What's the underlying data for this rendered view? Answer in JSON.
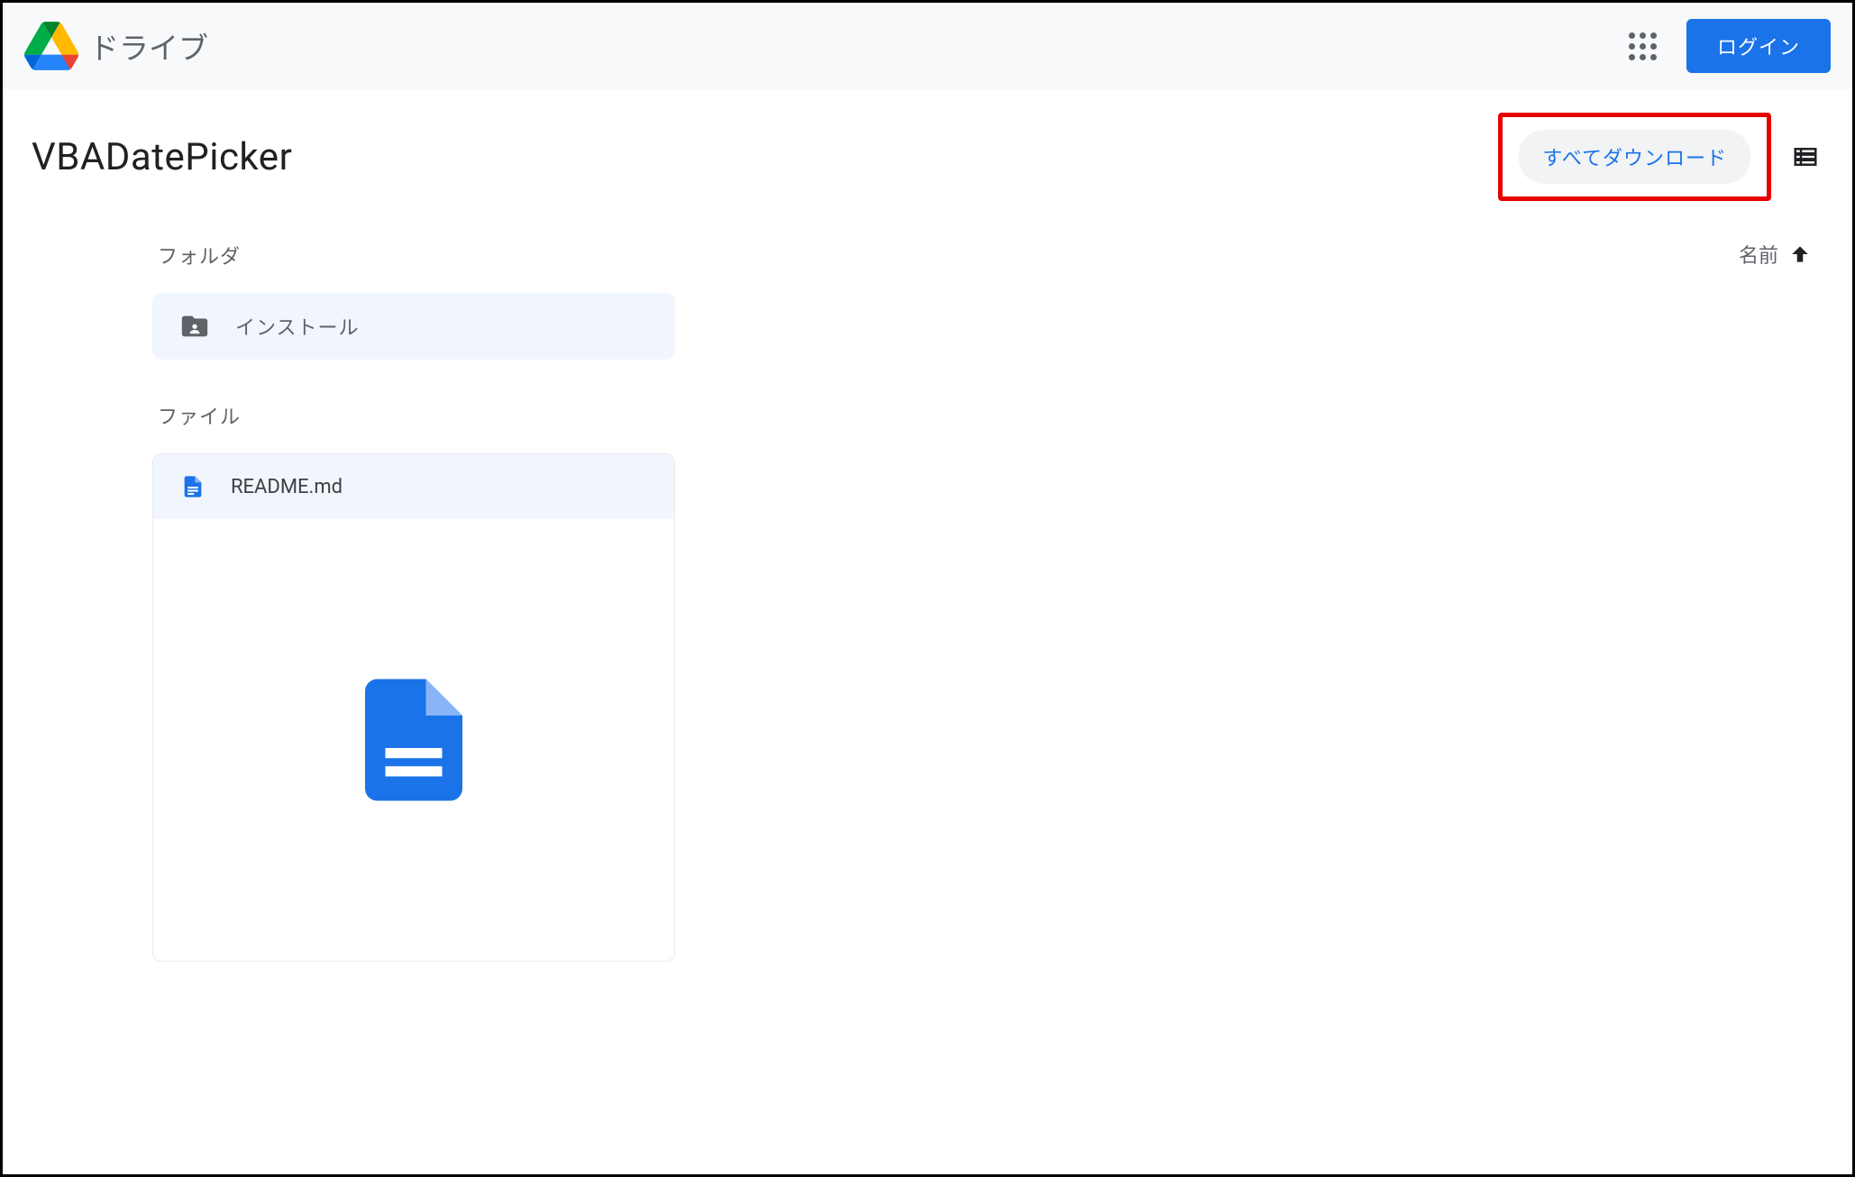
{
  "header": {
    "product_name": "ドライブ",
    "login_label": "ログイン"
  },
  "toolbar": {
    "title": "VBADatePicker",
    "download_all_label": "すべてダウンロード"
  },
  "sort": {
    "label": "名前"
  },
  "sections": {
    "folders_label": "フォルダ",
    "files_label": "ファイル"
  },
  "folders": [
    {
      "name": "インストール"
    }
  ],
  "files": [
    {
      "name": "README.md"
    }
  ]
}
